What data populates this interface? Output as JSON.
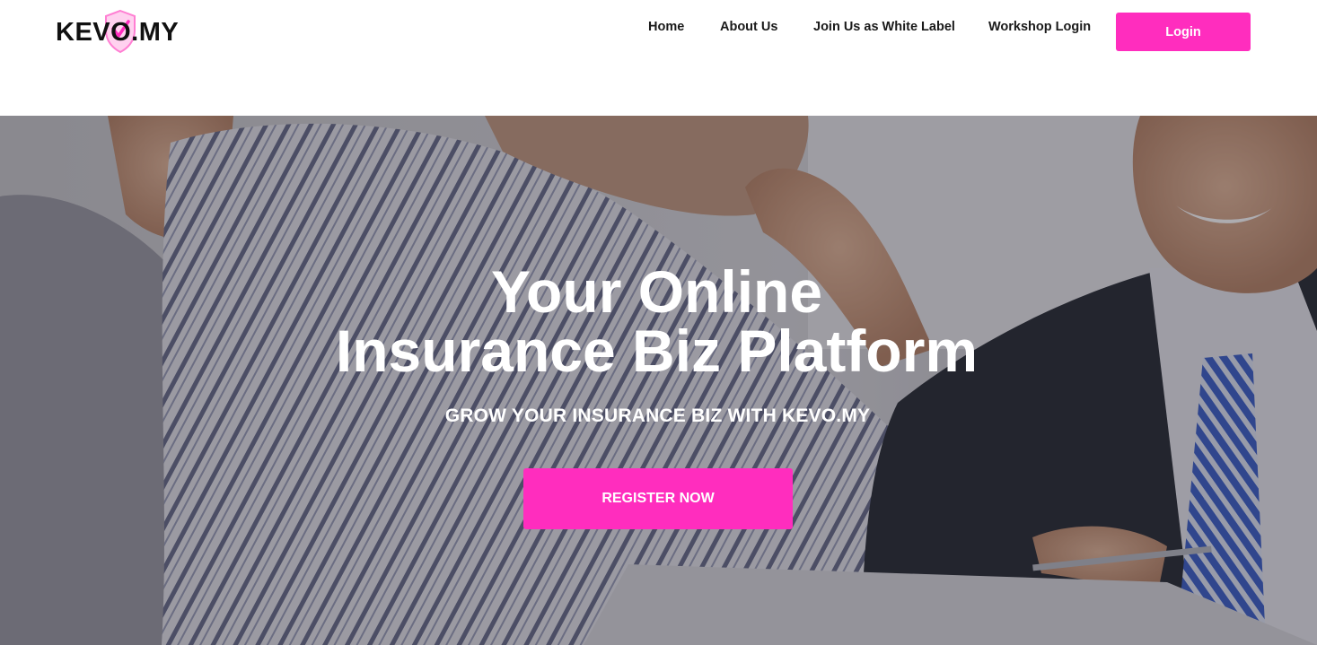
{
  "brand": {
    "logo_text": "KEVO.MY",
    "accent_color": "#ff2dbe"
  },
  "nav": {
    "items": [
      {
        "label": "Home"
      },
      {
        "label": "About Us"
      },
      {
        "label": "Join Us as White Label"
      },
      {
        "label": "Workshop Login"
      }
    ],
    "login_label": "Login"
  },
  "hero": {
    "title_line1": "Your Online",
    "title_line2": "Insurance Biz Platform",
    "subtitle": "GROW YOUR INSURANCE BIZ WITH KEVO.MY",
    "cta_label": "REGISTER NOW"
  }
}
